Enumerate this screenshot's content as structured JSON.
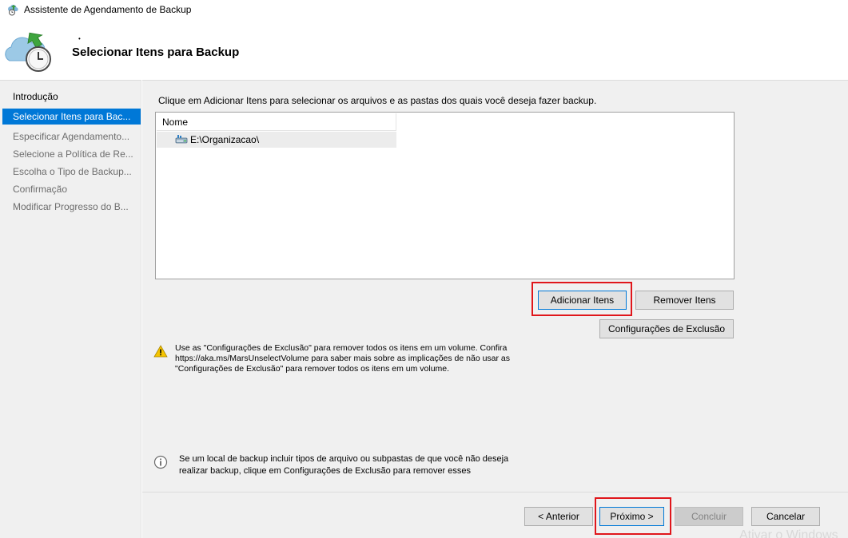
{
  "window": {
    "title": "Assistente de Agendamento de Backup"
  },
  "header": {
    "dot": "•",
    "heading": "Selecionar Itens para Backup"
  },
  "sidebar": {
    "steps": [
      {
        "label": "Introdução",
        "state": "done"
      },
      {
        "label": "Selecionar Itens para Bac...",
        "state": "active"
      },
      {
        "label": "Especificar Agendamento...",
        "state": "pending"
      },
      {
        "label": "Selecione a Política de Re...",
        "state": "pending"
      },
      {
        "label": "Escolha o Tipo de Backup...",
        "state": "pending"
      },
      {
        "label": "Confirmação",
        "state": "pending"
      },
      {
        "label": "Modificar Progresso do B...",
        "state": "pending"
      }
    ]
  },
  "main": {
    "instruction": "Clique em Adicionar Itens para selecionar os arquivos e as pastas dos quais você deseja fazer backup.",
    "list": {
      "column_header": "Nome",
      "items": [
        {
          "path": "E:\\Organizacao\\",
          "icon": "drive-icon"
        }
      ]
    },
    "buttons": {
      "add_items": "Adicionar Itens",
      "remove_items": "Remover Itens",
      "exclusion_settings": "Configurações de Exclusão"
    },
    "warning_text": "Use as \"Configurações de Exclusão\" para remover todos os itens em um volume. Confira https://aka.ms/MarsUnselectVolume para saber mais sobre as implicações de não usar as \"Configurações de Exclusão\" para remover todos os itens em um volume.",
    "info_text": "Se um local de backup incluir tipos de arquivo ou subpastas de que você não deseja realizar backup, clique em Configurações de Exclusão para remover esses"
  },
  "footer": {
    "previous": "< Anterior",
    "next": "Próximo >",
    "finish": "Concluir",
    "cancel": "Cancelar",
    "finish_enabled": false
  },
  "watermark": "Ativar o Windows",
  "colors": {
    "accent": "#0078d7",
    "highlight_box": "#e0161b",
    "panel": "#f0f0f0"
  }
}
